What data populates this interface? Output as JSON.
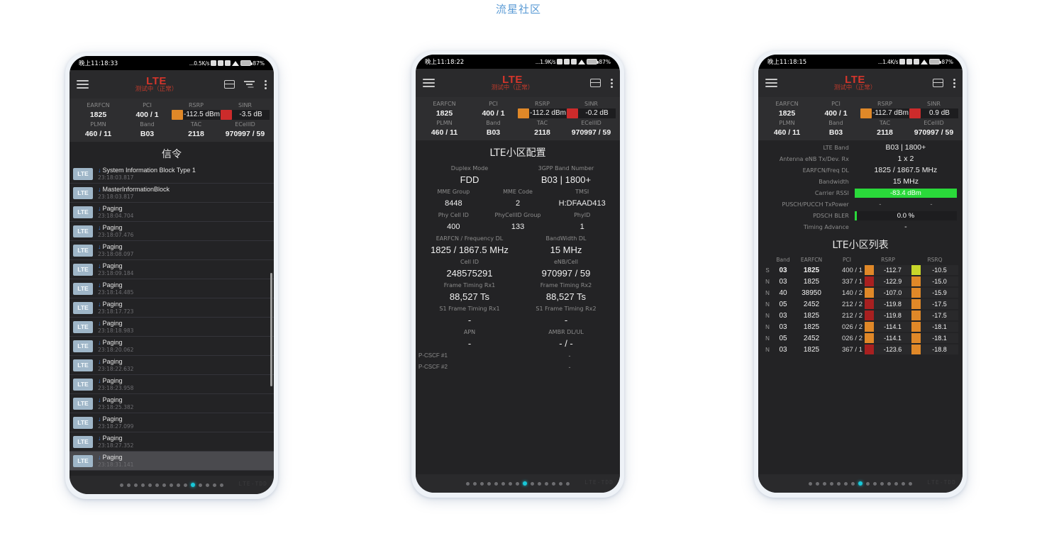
{
  "page": {
    "watermark": "流星社区"
  },
  "phones": [
    {
      "id": "phone1",
      "statusbar": {
        "time": "晚上11:18:33",
        "speed": "...0.5K/s",
        "battery_pct": "87%"
      },
      "appbar": {
        "title": "LTE",
        "subtitle": "测试中（正常）",
        "menu_icon": "hamburger-icon",
        "card_icon": "card-icon",
        "filter_icon": "filter-icon",
        "overflow_icon": "more-vertical-icon"
      },
      "metrics": {
        "labels_row1": [
          "EARFCN",
          "PCI",
          "RSRP",
          "SINR"
        ],
        "values_row1": [
          "1825",
          "400 / 1",
          "-112.5 dBm",
          "-3.5 dB"
        ],
        "rsrp_bar_color": "#e08828",
        "sinr_bar_color": "#cc2b2b",
        "labels_row2": [
          "PLMN",
          "Band",
          "TAC",
          "ECellID"
        ],
        "values_row2": [
          "460 / 11",
          "B03",
          "2118",
          "970997 / 59"
        ]
      },
      "section_title": "信令",
      "signaling": [
        {
          "tag": "LTE",
          "name": "System Information Block Type 1",
          "time": "23:18:03.817"
        },
        {
          "tag": "LTE",
          "name": "MasterInformationBlock",
          "time": "23:18:03.817"
        },
        {
          "tag": "LTE",
          "name": "Paging",
          "time": "23:18:04.704"
        },
        {
          "tag": "LTE",
          "name": "Paging",
          "time": "23:18:07.476"
        },
        {
          "tag": "LTE",
          "name": "Paging",
          "time": "23:18:08.097"
        },
        {
          "tag": "LTE",
          "name": "Paging",
          "time": "23:18:09.184"
        },
        {
          "tag": "LTE",
          "name": "Paging",
          "time": "23:18:14.485"
        },
        {
          "tag": "LTE",
          "name": "Paging",
          "time": "23:18:17.723"
        },
        {
          "tag": "LTE",
          "name": "Paging",
          "time": "23:18:18.983"
        },
        {
          "tag": "LTE",
          "name": "Paging",
          "time": "23:18:20.062"
        },
        {
          "tag": "LTE",
          "name": "Paging",
          "time": "23:18:22.632"
        },
        {
          "tag": "LTE",
          "name": "Paging",
          "time": "23:18:23.958"
        },
        {
          "tag": "LTE",
          "name": "Paging",
          "time": "23:18:25.382"
        },
        {
          "tag": "LTE",
          "name": "Paging",
          "time": "23:18:27.099"
        },
        {
          "tag": "LTE",
          "name": "Paging",
          "time": "23:18:27.352"
        },
        {
          "tag": "LTE",
          "name": "Paging",
          "time": "23:18:31.141"
        }
      ],
      "pager": {
        "dots": 15,
        "active_index": 10,
        "watermark": "LTE-TDD"
      }
    },
    {
      "id": "phone2",
      "statusbar": {
        "time": "晚上11:18:22",
        "speed": "...1.9K/s",
        "battery_pct": "87%"
      },
      "appbar": {
        "title": "LTE",
        "subtitle": "测试中（正常）",
        "menu_icon": "hamburger-icon",
        "card_icon": "card-icon",
        "overflow_icon": "more-vertical-icon"
      },
      "metrics": {
        "labels_row1": [
          "EARFCN",
          "PCI",
          "RSRP",
          "SINR"
        ],
        "values_row1": [
          "1825",
          "400 / 1",
          "-112.2 dBm",
          "-0.2 dB"
        ],
        "rsrp_bar_color": "#e08828",
        "sinr_bar_color": "#cc2b2b",
        "labels_row2": [
          "PLMN",
          "Band",
          "TAC",
          "ECellID"
        ],
        "values_row2": [
          "460 / 11",
          "B03",
          "2118",
          "970997 / 59"
        ]
      },
      "section_title": "LTE小区配置",
      "config_rows": [
        {
          "labels": [
            "Duplex Mode",
            "3GPP Band Number"
          ],
          "values": [
            "FDD",
            "B03 | 1800+"
          ],
          "cols": 2
        },
        {
          "labels": [
            "MME Group",
            "MME Code",
            "TMSI"
          ],
          "values": [
            "8448",
            "2",
            "H:DFAAD413"
          ],
          "cols": 3
        },
        {
          "labels": [
            "Phy Cell ID",
            "PhyCellID Group",
            "PhyID"
          ],
          "values": [
            "400",
            "133",
            "1"
          ],
          "cols": 3
        },
        {
          "labels": [
            "EARFCN / Frequency DL",
            "BandWidth DL"
          ],
          "values": [
            "1825 / 1867.5 MHz",
            "15 MHz"
          ],
          "cols": 2
        },
        {
          "labels": [
            "Cell ID",
            "eNB/Cell"
          ],
          "values": [
            "248575291",
            "970997 / 59"
          ],
          "cols": 2
        },
        {
          "labels": [
            "Frame Timing Rx1",
            "Frame Timing Rx2"
          ],
          "values": [
            "88,527 Ts",
            "88,527 Ts"
          ],
          "cols": 2
        },
        {
          "labels": [
            "S1 Frame Timing Rx1",
            "S1 Frame Timing Rx2"
          ],
          "values": [
            "-",
            "-"
          ],
          "cols": 2
        },
        {
          "labels": [
            "APN",
            "AMBR DL/UL"
          ],
          "values": [
            "-",
            "- / -"
          ],
          "cols": 2
        }
      ],
      "pcscf": [
        {
          "label": "P-CSCF #1",
          "value": "-"
        },
        {
          "label": "P-CSCF #2",
          "value": "-"
        }
      ],
      "pager": {
        "dots": 15,
        "active_index": 8,
        "watermark": "LTE-TDD"
      }
    },
    {
      "id": "phone3",
      "statusbar": {
        "time": "晚上11:18:15",
        "speed": "...1.4K/s",
        "battery_pct": "87%"
      },
      "appbar": {
        "title": "LTE",
        "subtitle": "测试中（正常）",
        "menu_icon": "hamburger-icon",
        "card_icon": "card-icon",
        "overflow_icon": "more-vertical-icon"
      },
      "metrics": {
        "labels_row1": [
          "EARFCN",
          "PCI",
          "RSRP",
          "SINR"
        ],
        "values_row1": [
          "1825",
          "400 / 1",
          "-112.7 dBm",
          "0.9 dB"
        ],
        "rsrp_bar_color": "#e08828",
        "sinr_bar_color": "#cc2b2b",
        "labels_row2": [
          "PLMN",
          "Band",
          "TAC",
          "ECellID"
        ],
        "values_row2": [
          "460 / 11",
          "B03",
          "2118",
          "970997 / 59"
        ]
      },
      "radio_rows": [
        {
          "label": "LTE Band",
          "value": "B03 | 1800+",
          "type": "text"
        },
        {
          "label": "Antenna eNB Tx/Dev. Rx",
          "value": "1 x 2",
          "type": "text"
        },
        {
          "label": "EARFCN/Freq DL",
          "value": "1825 / 1867.5 MHz",
          "type": "text"
        },
        {
          "label": "Bandwidth",
          "value": "15 MHz",
          "type": "text"
        },
        {
          "label": "Carrier RSSI",
          "value": "-83.4 dBm",
          "type": "bar",
          "fill_pct": 100,
          "color": "#2ad93a"
        },
        {
          "label": "PUSCH/PUCCH TxPower",
          "value": "-",
          "value2": "-",
          "type": "split"
        },
        {
          "label": "PDSCH BLER",
          "value": "0.0 %",
          "type": "bar",
          "fill_pct": 2,
          "color": "#2ad93a"
        },
        {
          "label": "Timing Advance",
          "value": "-",
          "type": "text"
        }
      ],
      "cell_list_title": "LTE小区列表",
      "cell_table": {
        "headers": [
          "",
          "Band",
          "EARFCN",
          "PCI",
          "RSRP",
          "RSRQ"
        ],
        "rows": [
          {
            "s": "S",
            "band": "03",
            "earfcn": "1825",
            "pci": "400 / 1",
            "rsrp": "-112.7",
            "rsrp_color": "#e08828",
            "rsrq": "-10.5",
            "rsrq_color": "#c8d62a"
          },
          {
            "s": "N",
            "band": "03",
            "earfcn": "1825",
            "pci": "337 / 1",
            "rsrp": "-122.9",
            "rsrp_color": "#a82020",
            "rsrq": "-15.0",
            "rsrq_color": "#e08828"
          },
          {
            "s": "N",
            "band": "40",
            "earfcn": "38950",
            "pci": "140 / 2",
            "rsrp": "-107.0",
            "rsrp_color": "#e08828",
            "rsrq": "-15.9",
            "rsrq_color": "#e08828"
          },
          {
            "s": "N",
            "band": "05",
            "earfcn": "2452",
            "pci": "212 / 2",
            "rsrp": "-119.8",
            "rsrp_color": "#a82020",
            "rsrq": "-17.5",
            "rsrq_color": "#e08828"
          },
          {
            "s": "N",
            "band": "03",
            "earfcn": "1825",
            "pci": "212 / 2",
            "rsrp": "-119.8",
            "rsrp_color": "#a82020",
            "rsrq": "-17.5",
            "rsrq_color": "#e08828"
          },
          {
            "s": "N",
            "band": "03",
            "earfcn": "1825",
            "pci": "026 / 2",
            "rsrp": "-114.1",
            "rsrp_color": "#e08828",
            "rsrq": "-18.1",
            "rsrq_color": "#e08828"
          },
          {
            "s": "N",
            "band": "05",
            "earfcn": "2452",
            "pci": "026 / 2",
            "rsrp": "-114.1",
            "rsrp_color": "#e08828",
            "rsrq": "-18.1",
            "rsrq_color": "#e08828"
          },
          {
            "s": "N",
            "band": "03",
            "earfcn": "1825",
            "pci": "367 / 1",
            "rsrp": "-123.6",
            "rsrp_color": "#a82020",
            "rsrq": "-18.8",
            "rsrq_color": "#e08828"
          }
        ]
      },
      "pager": {
        "dots": 15,
        "active_index": 7,
        "watermark": "LTE-TDD"
      }
    }
  ]
}
